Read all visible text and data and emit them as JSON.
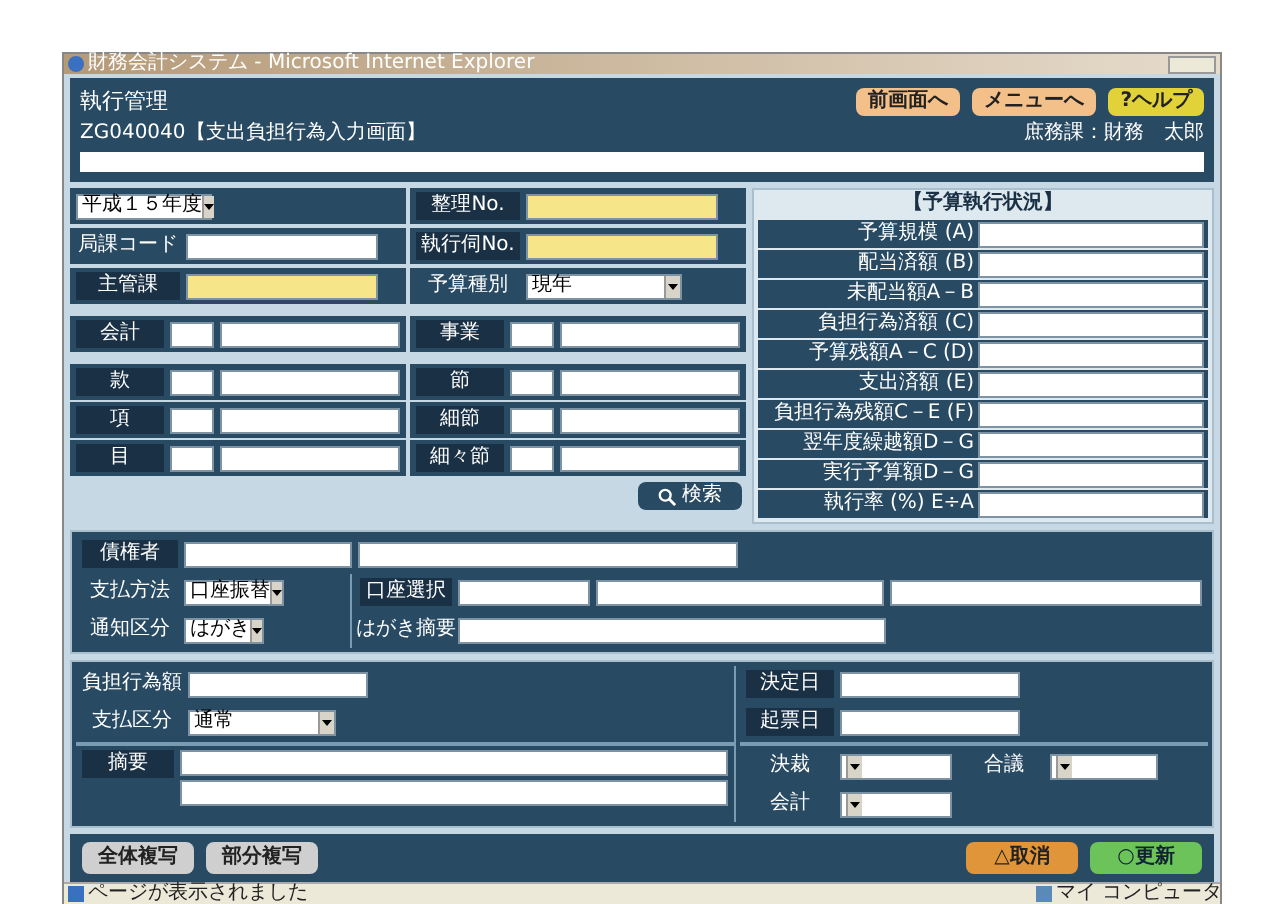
{
  "window": {
    "title": "財務会計システム - Microsoft Internet Explorer"
  },
  "header": {
    "title": "執行管理",
    "screen": "ZG040040【支出負担行為入力画面】",
    "user": "庶務課：財務　太郎",
    "buttons": [
      {
        "label": "前画面へ",
        "kind": "nav"
      },
      {
        "label": "メニューへ",
        "kind": "nav"
      },
      {
        "label": "?ヘルプ",
        "kind": "help"
      }
    ]
  },
  "basic": {
    "left": [
      {
        "kind": "select",
        "value": "平成１５年度"
      },
      {
        "kind": "input",
        "label": "局課コード",
        "required": false
      },
      {
        "kind": "input",
        "label": "主管課",
        "required": true
      }
    ],
    "right": [
      {
        "kind": "input",
        "label": "整理No.",
        "required": true
      },
      {
        "kind": "input",
        "label": "執行伺No.",
        "required": true
      },
      {
        "kind": "select",
        "label": "予算種別",
        "value": "現年"
      }
    ]
  },
  "accounting": [
    {
      "label": "会計"
    },
    {
      "label": "事業"
    }
  ],
  "budget_codes": [
    {
      "label": "款"
    },
    {
      "label": "節"
    },
    {
      "label": "項"
    },
    {
      "label": "細節"
    },
    {
      "label": "目"
    },
    {
      "label": "細々節"
    }
  ],
  "search_button": "検索",
  "budget_status": {
    "title": "【予算執行状況】",
    "rows": [
      "予算規模 (A)",
      "配当済額 (B)",
      "未配当額A－B",
      "負担行為済額 (C)",
      "予算残額A－C (D)",
      "支出済額 (E)",
      "負担行為残額C－E (F)",
      "翌年度繰越額D－G",
      "実行予算額D－G",
      "執行率 (%) E÷A"
    ]
  },
  "payment": {
    "creditor": "債権者",
    "method": {
      "label": "支払方法",
      "value": "口座振替"
    },
    "account": "口座選択",
    "notice": {
      "label": "通知区分",
      "value": "はがき"
    },
    "postcard_note": "はがき摘要"
  },
  "commitment": {
    "amount": "負担行為額",
    "decision_date": "決定日",
    "payment_type": {
      "label": "支払区分",
      "value": "通常"
    },
    "entry_date": "起票日",
    "summary": "摘要",
    "approvals": [
      {
        "label": "決裁"
      },
      {
        "label": "合議"
      },
      {
        "label": "会計"
      }
    ]
  },
  "footer_buttons": [
    {
      "label": "全体複写",
      "kind": "copy"
    },
    {
      "label": "部分複写",
      "kind": "copy"
    },
    {
      "label": "△取消",
      "kind": "cancel"
    },
    {
      "label": "○更新",
      "kind": "update"
    }
  ],
  "status_bar": {
    "message": "ページが表示されました",
    "zone": "マイ コンピュータ"
  }
}
